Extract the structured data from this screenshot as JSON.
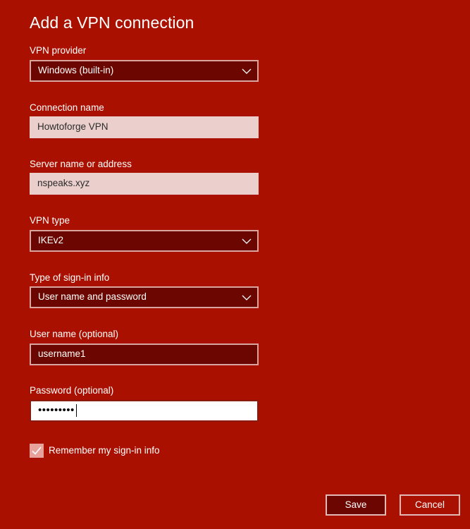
{
  "dialog": {
    "title": "Add a VPN connection"
  },
  "fields": {
    "vpn_provider": {
      "label": "VPN provider",
      "value": "Windows (built-in)"
    },
    "connection_name": {
      "label": "Connection name",
      "value": "Howtoforge VPN"
    },
    "server": {
      "label": "Server name or address",
      "value": "nspeaks.xyz"
    },
    "vpn_type": {
      "label": "VPN type",
      "value": "IKEv2"
    },
    "signin_type": {
      "label": "Type of sign-in info",
      "value": "User name and password"
    },
    "username": {
      "label": "User name (optional)",
      "value": "username1"
    },
    "password": {
      "label": "Password (optional)",
      "value": "•••••••••"
    }
  },
  "remember": {
    "label": "Remember my sign-in info",
    "checked": true
  },
  "buttons": {
    "save": "Save",
    "cancel": "Cancel"
  },
  "icons": {
    "dropdown": "chevron-down-icon",
    "checkbox": "checkmark-icon"
  },
  "colors": {
    "background": "#aa1000",
    "field_dark": "#6b0700",
    "field_light": "#ebcfcc",
    "border": "#d9a59f"
  }
}
